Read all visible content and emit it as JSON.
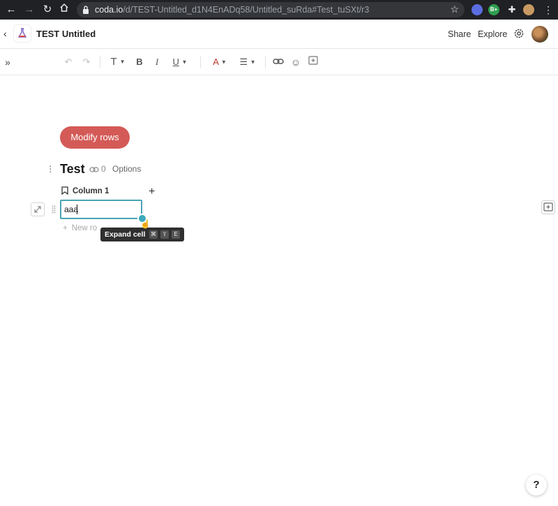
{
  "browser": {
    "url_host": "coda.io",
    "url_path": "/d/TEST-Untitled_d1N4EnADq58/Untitled_suRda#Test_tuSXt/r3",
    "extension_badge": "B+"
  },
  "header": {
    "doc_title": "TEST Untitled",
    "share_label": "Share",
    "explore_label": "Explore"
  },
  "toolbar": {
    "text_style_glyph": "T",
    "bold_glyph": "B",
    "italic_glyph": "I",
    "underline_glyph": "U",
    "text_color_glyph": "A",
    "text_color": "#c0392b"
  },
  "canvas": {
    "modify_button_label": "Modify rows",
    "table_title": "Test",
    "link_count": "0",
    "options_label": "Options",
    "column_header": "Column 1",
    "cell_value": "aaa",
    "new_row_label": "New ro",
    "tooltip": {
      "label": "Expand cell",
      "keys": [
        "⌘",
        "⇧",
        "E"
      ]
    }
  },
  "help_label": "?",
  "colors": {
    "accent_button": "#d45a57",
    "cell_border": "#4aa3b5",
    "browser_bar": "#202124"
  }
}
